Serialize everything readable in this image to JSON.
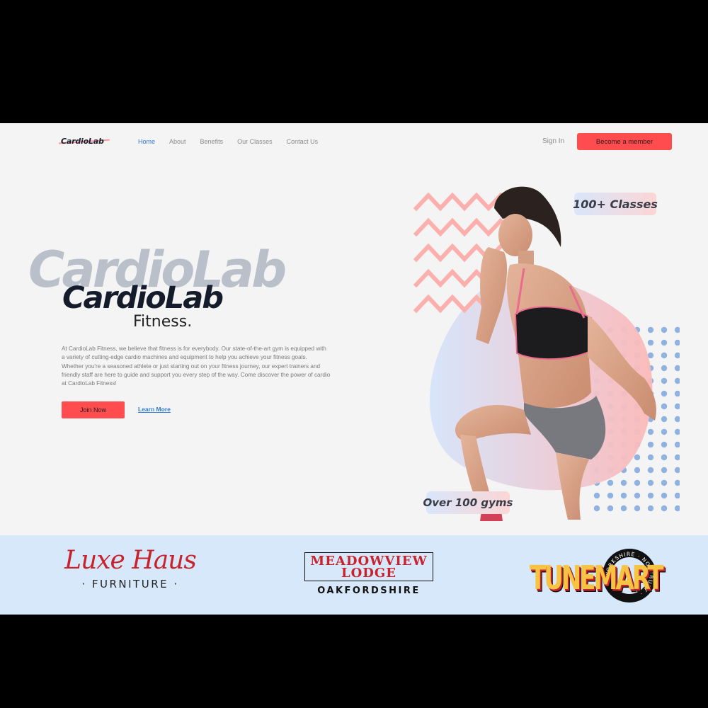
{
  "nav": {
    "logo": "CardioLab",
    "links": [
      "Home",
      "About",
      "Benefits",
      "Our Classes",
      "Contact Us"
    ],
    "active_link": "Home",
    "sign_in": "Sign In",
    "cta": "Become a member"
  },
  "hero": {
    "ghost_title": "CardioLab",
    "title": "CardioLab",
    "subtitle": "Fitness.",
    "paragraph": "At CardioLab Fitness, we believe that fitness is for everybody. Our state-of-the-art gym is equipped with a variety of cutting-edge cardio machines and equipment to help you achieve your fitness goals. Whether you're a seasoned athlete or just starting out on your fitness journey, our expert trainers and friendly staff are here to guide and support you every step of the way. Come discover the power of cardio at CardioLab Fitness!",
    "join_button": "Join Now",
    "learn_more": "Learn More",
    "badge_classes": "100+ Classes",
    "badge_gyms": "Over 100 gyms"
  },
  "brands": {
    "luxe": {
      "name": "Luxe Haus",
      "sub": "· FURNITURE ·"
    },
    "meadow": {
      "name_line1": "MEADOWVIEW",
      "name_line2": "LODGE",
      "sub": "OAKFORDSHIRE"
    },
    "tune": {
      "name": "TUNEMART",
      "ring_text": "YORKSHIRE · NOTEBURY ·"
    }
  },
  "colors": {
    "accent_red": "#ff4d4f",
    "link_blue": "#2f7bd6",
    "dark_navy": "#141c2b",
    "brand_strip": "#d8e8fb"
  }
}
